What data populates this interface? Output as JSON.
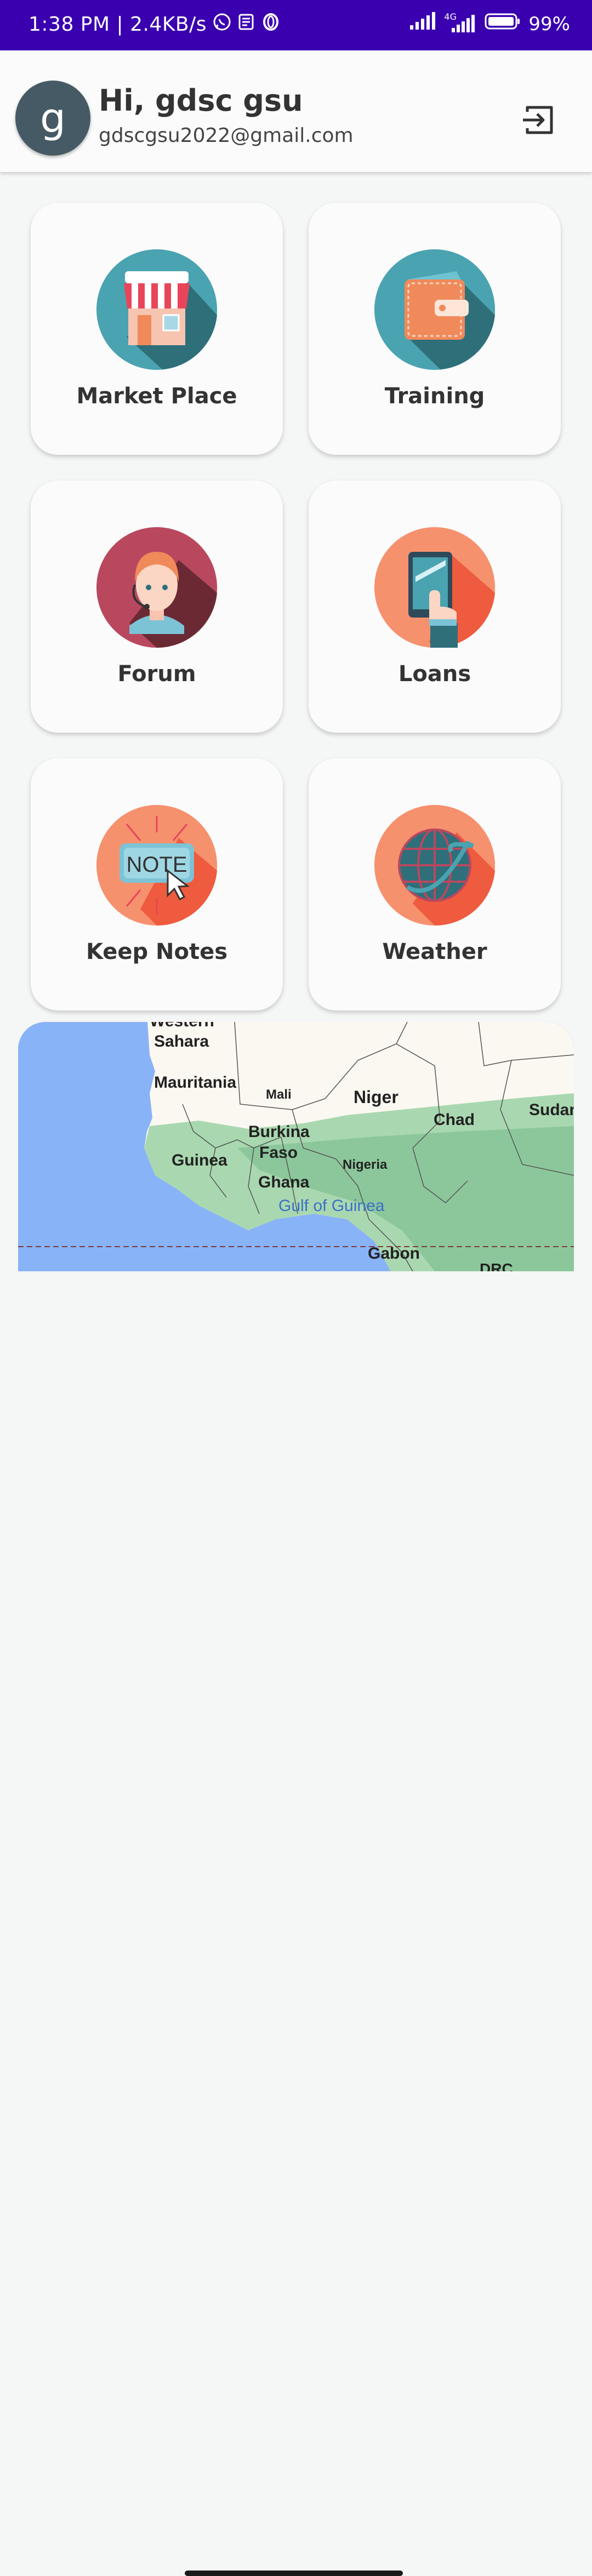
{
  "status_bar": {
    "time_speed": "1:38 PM | 2.4KB/s",
    "network": "4G",
    "battery": "99%"
  },
  "header": {
    "avatar_letter": "g",
    "greeting": "Hi, gdsc gsu",
    "email": "gdscgsu2022@gmail.com"
  },
  "cards": [
    {
      "label": "Market Place",
      "icon": "store-icon"
    },
    {
      "label": "Training",
      "icon": "wallet-icon"
    },
    {
      "label": "Forum",
      "icon": "support-agent-icon"
    },
    {
      "label": "Loans",
      "icon": "phone-tap-icon"
    },
    {
      "label": "Keep Notes",
      "icon": "note-icon"
    },
    {
      "label": "Weather",
      "icon": "globe-icon"
    }
  ],
  "map": {
    "labels": [
      "Western",
      "Sahara",
      "Mauritania",
      "Mali",
      "Niger",
      "Chad",
      "Sudan",
      "Burkina",
      "Faso",
      "Guinea",
      "Nigeria",
      "Ghana",
      "Gulf of Guinea",
      "Gabon",
      "DRC"
    ]
  },
  "colors": {
    "status_bar": "#3a00b0",
    "icon_teal": "#4aa3b0",
    "icon_coral": "#f08a6a",
    "icon_rose": "#b9485f"
  }
}
